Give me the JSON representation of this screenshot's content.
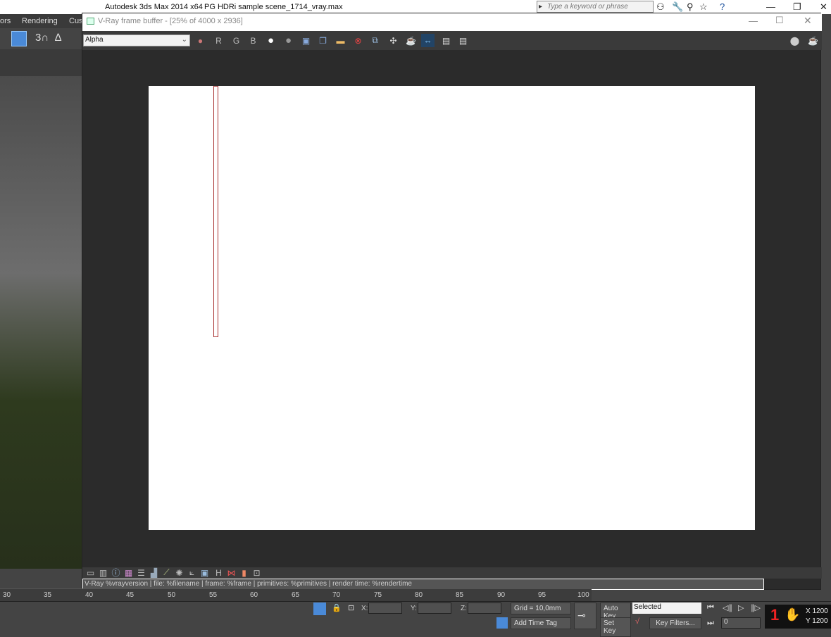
{
  "max": {
    "app_title": "Autodesk 3ds Max  2014 x64",
    "file_title": "PG HDRi sample scene_1714_vray.max",
    "search_placeholder": "Type a keyword or phrase",
    "menus": [
      "ors",
      "Rendering",
      "Cus"
    ]
  },
  "vfb": {
    "title": "V-Ray frame buffer - [25% of 4000 x 2936]",
    "channel": "Alpha",
    "rgb": [
      "R",
      "G",
      "B"
    ],
    "status_line": "V-Ray %vrayversion | file: %filename | frame: %frame | primitives: %primitives | render time: %rendertime"
  },
  "ruler": [
    "30",
    "35",
    "40",
    "45",
    "50",
    "55",
    "60",
    "65",
    "70",
    "75",
    "80",
    "85",
    "90",
    "95",
    "100"
  ],
  "bottom": {
    "x_label": "X:",
    "y_label": "Y:",
    "z_label": "Z:",
    "grid": "Grid = 10,0mm",
    "add_time_tag": "Add Time Tag",
    "auto_key": "Auto Key",
    "set_key": "Set Key",
    "key_mode": "Selected",
    "key_filters": "Key Filters...",
    "frame": "0",
    "coord_x": "X 1200",
    "coord_y": "Y 1200"
  }
}
